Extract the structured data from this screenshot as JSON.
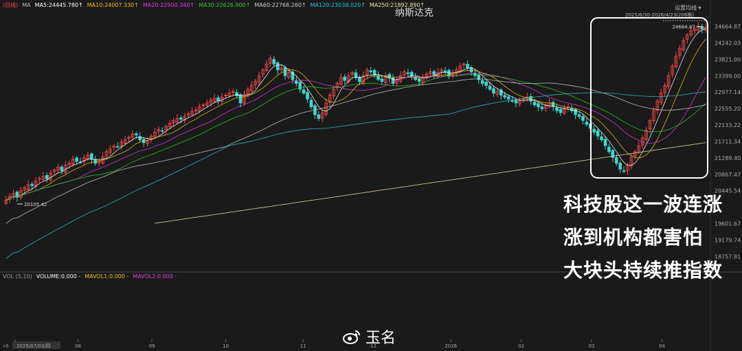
{
  "title": "纳斯达克",
  "settings_label": "设置均线",
  "date_range": "2025/6/30-2026/4/23(206根)",
  "period_tag": "日线",
  "ma_indicators": [
    {
      "label": "MA",
      "color": "#bbbbbb"
    },
    {
      "label": "MA5:24445.780↑",
      "color": "#ffffff"
    },
    {
      "label": "MA10:24007.330↑",
      "color": "#f0c419"
    },
    {
      "label": "MA20:22900.340↑",
      "color": "#e040e0"
    },
    {
      "label": "MA30:22626.900↑",
      "color": "#33cc33"
    },
    {
      "label": "MA60:22768.260↑",
      "color": "#cccccc"
    },
    {
      "label": "MA120:23038.020↑",
      "color": "#2ec4d6"
    },
    {
      "label": "MA250:21892.890↑",
      "color": "#f5e6a8"
    }
  ],
  "volume_indicators": [
    {
      "label": "VOL (5,10)",
      "color": "#999999"
    },
    {
      "label": "VOLUME:0.000 -",
      "color": "#ffffff"
    },
    {
      "label": "MAVOL1:0.000 -",
      "color": "#f0c419"
    },
    {
      "label": "MAVOL2:0.000 -",
      "color": "#e040e0"
    }
  ],
  "captions": [
    "科技股这一波连涨",
    "涨到机构都害怕",
    "大块头持续推指数"
  ],
  "watermark": "玉名",
  "colors": {
    "up": "#ff4a4a",
    "down": "#3dd6d0",
    "highlight_box": "#ffffff"
  },
  "chart_data": {
    "type": "candlestick",
    "y_range": [
      18500,
      24850
    ],
    "y_ticks": [
      "24664.87",
      "24242.03",
      "23821.00",
      "23399.00",
      "22977.14",
      "22555.20",
      "22133.22",
      "21711.34",
      "21289.40",
      "20867.47",
      "20445.54",
      "19601.67",
      "19179.74",
      "18757.81"
    ],
    "y_tick_values": [
      24664.87,
      24242.03,
      23821.0,
      23399.0,
      22977.14,
      22555.2,
      22133.22,
      21711.34,
      21289.4,
      20867.47,
      20445.54,
      19601.67,
      19179.74,
      18757.81
    ],
    "x_tick_labels": [
      "2025/07/03/四",
      "08",
      "09",
      "10",
      "11",
      "12",
      "2026",
      "02",
      "03",
      "04"
    ],
    "x_tick_positions": [
      0.0,
      0.105,
      0.21,
      0.315,
      0.425,
      0.525,
      0.635,
      0.735,
      0.835,
      0.935
    ],
    "annotations": [
      {
        "label": "20105.42",
        "value": 20105.42
      },
      {
        "label": "24664.87",
        "value": 24664.87
      }
    ],
    "closes": [
      20200,
      20310,
      20380,
      20280,
      20450,
      20520,
      20600,
      20580,
      20700,
      20760,
      20820,
      20750,
      20900,
      20980,
      21050,
      20960,
      21100,
      21150,
      21250,
      21200,
      21180,
      21300,
      21360,
      21250,
      21150,
      21200,
      21320,
      21450,
      21520,
      21600,
      21580,
      21700,
      21760,
      21820,
      21900,
      21880,
      21750,
      21680,
      21720,
      21850,
      21950,
      22020,
      21980,
      22100,
      22180,
      22250,
      22300,
      22280,
      22350,
      22420,
      22480,
      22520,
      22600,
      22650,
      22700,
      22780,
      22820,
      22760,
      22850,
      22900,
      22950,
      23000,
      22880,
      22700,
      22920,
      23050,
      23150,
      23250,
      23400,
      23550,
      23700,
      23850,
      23700,
      23550,
      23600,
      23400,
      23480,
      23300,
      23200,
      23050,
      22950,
      22800,
      22600,
      22400,
      22300,
      22450,
      22700,
      22900,
      23050,
      23200,
      23350,
      23280,
      23400,
      23480,
      23350,
      23250,
      23400,
      23550,
      23500,
      23420,
      23300,
      23250,
      23400,
      23350,
      23200,
      23300,
      23400,
      23500,
      23450,
      23380,
      23300,
      23250,
      23350,
      23450,
      23500,
      23420,
      23480,
      23550,
      23500,
      23400,
      23450,
      23550,
      23650,
      23700,
      23600,
      23500,
      23400,
      23300,
      23200,
      23150,
      23050,
      22950,
      23000,
      22900,
      22850,
      22800,
      22750,
      22700,
      22750,
      22800,
      22850,
      22750,
      22650,
      22600,
      22550,
      22650,
      22700,
      22600,
      22500,
      22450,
      22550,
      22600,
      22500,
      22400,
      22350,
      22250,
      22150,
      22050,
      21950,
      21850,
      21750,
      21600,
      21450,
      21300,
      21150,
      21000,
      20950,
      21100,
      21300,
      21450,
      21600,
      21800,
      22000,
      22250,
      22500,
      22750,
      22950,
      23150,
      23400,
      23650,
      23900,
      24100,
      24300,
      24450,
      24550,
      24600,
      24650,
      24600,
      24650
    ]
  }
}
